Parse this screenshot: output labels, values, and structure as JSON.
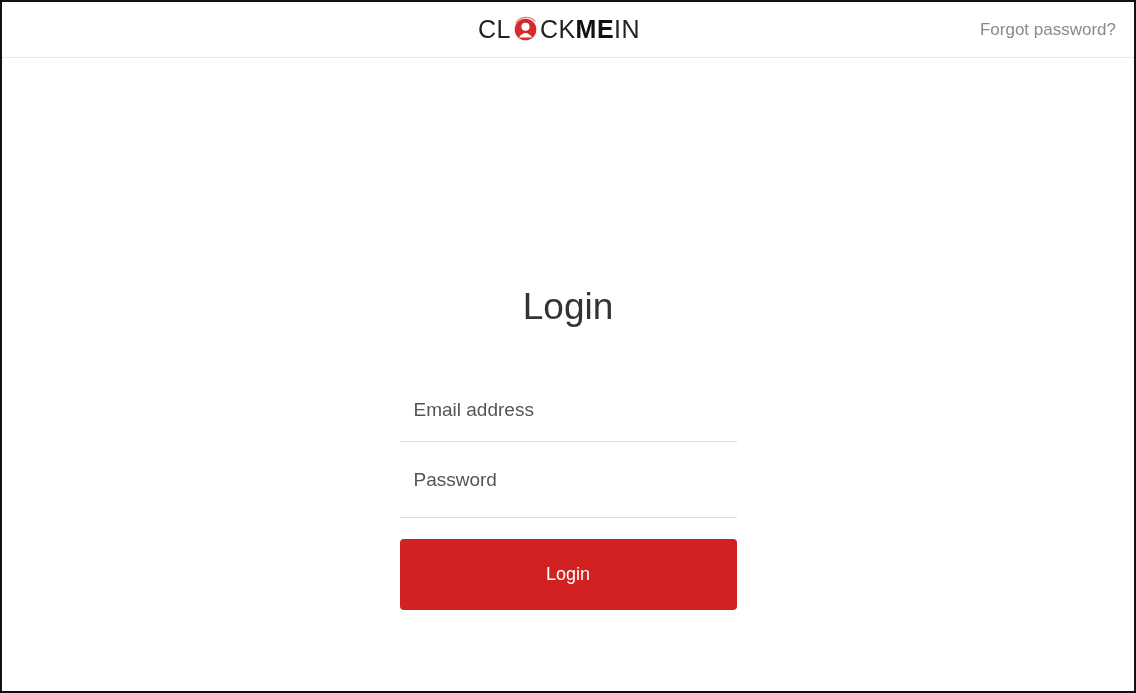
{
  "header": {
    "logo": {
      "text_before": "CL",
      "text_after": "CK**ME**IN"
    },
    "forgot_link": "Forgot password?"
  },
  "form": {
    "title": "Login",
    "fields": [
      {
        "placeholder": "Email address"
      },
      {
        "placeholder": "Password"
      }
    ],
    "submit": "Login"
  }
}
